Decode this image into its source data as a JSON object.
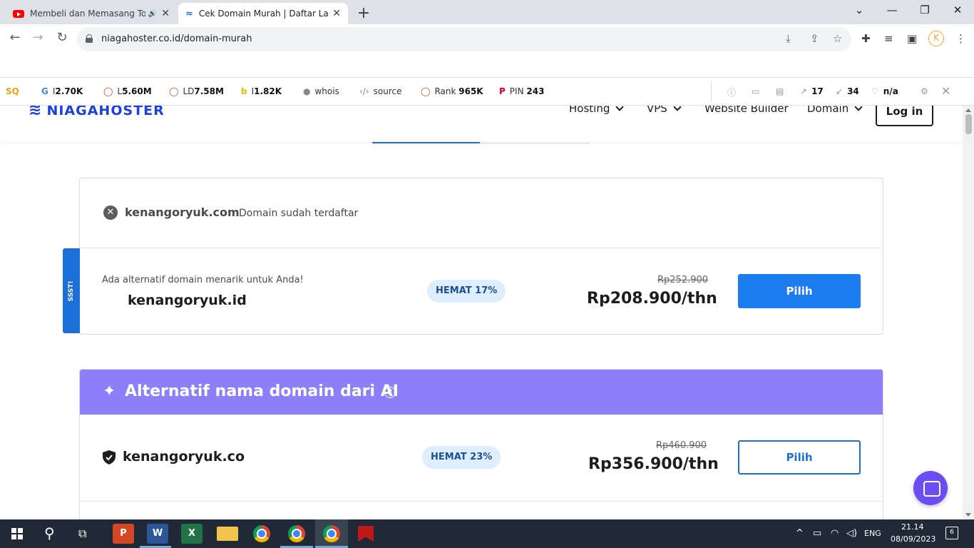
{
  "browser": {
    "tabs": [
      {
        "title": "Membeli dan Memasang Top",
        "icon": "youtube-icon",
        "audio": "🔊"
      },
      {
        "title": "Cek Domain Murah | Daftar Lang",
        "icon": "niagahoster-icon"
      }
    ],
    "new_tab": "+",
    "url": "niagahoster.co.id/domain-murah"
  },
  "seo_toolbar": {
    "items": [
      {
        "icon": "google-icon",
        "label": "I",
        "value": "2.70K"
      },
      {
        "icon": "circle-icon",
        "label": "L",
        "value": "5.60M"
      },
      {
        "icon": "circle-icon",
        "label": "LD",
        "value": "7.58M"
      },
      {
        "icon": "bing-icon",
        "label": "I",
        "value": "1.82K"
      },
      {
        "icon": "person-icon",
        "label": "whois",
        "value": ""
      },
      {
        "icon": "code-icon",
        "label": "source",
        "value": ""
      },
      {
        "icon": "circle-icon",
        "label": "Rank",
        "value": "965K"
      },
      {
        "icon": "pinterest-icon",
        "label": "PIN",
        "value": "243"
      }
    ],
    "right": {
      "ext_links": "17",
      "int_links": "34",
      "heart": "n/a"
    }
  },
  "site": {
    "logo": "NIAGAHOSTER",
    "menu": [
      "Hosting",
      "VPS",
      "Website Builder",
      "Domain"
    ],
    "login": "Log in"
  },
  "search_result": {
    "taken_domain": "kenangoryuk.com",
    "taken_status": "Domain sudah terdaftar",
    "ribbon": "SSST!",
    "alt_caption": "Ada alternatif domain menarik untuk Anda!",
    "alt_domain": "kenangoryuk.id",
    "badge": "HEMAT 17%",
    "old_price": "Rp252.900",
    "new_price": "Rp208.900/thn",
    "button": "Pilih"
  },
  "ai_section": {
    "title": "Alternatif nama domain dari AI",
    "help": "?",
    "items": [
      {
        "domain": "kenangoryuk.co",
        "badge": "HEMAT 23%",
        "old_price": "Rp460.900",
        "new_price": "Rp356.900/thn",
        "button": "Pilih"
      }
    ]
  },
  "taskbar": {
    "lang": "ENG",
    "time": "21.14",
    "date": "08/09/2023",
    "notifications": "6"
  }
}
